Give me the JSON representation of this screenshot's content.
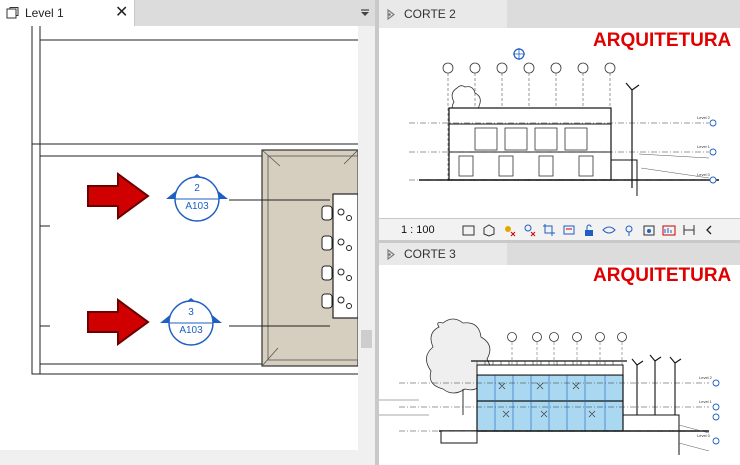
{
  "left_view": {
    "tab_label": "Level 1",
    "callouts": [
      {
        "number": "2",
        "sheet": "A103"
      },
      {
        "number": "3",
        "sheet": "A103"
      }
    ]
  },
  "right_top": {
    "tab_label": "CORTE 2",
    "discipline_title": "ARQUITETURA",
    "scale": "1 : 100"
  },
  "right_bottom": {
    "tab_label": "CORTE 3",
    "discipline_title": "ARQUITETURA"
  },
  "icons": {
    "view_tab": "floor-plan-view-icon",
    "section_tab": "section-view-icon",
    "close": "close-icon",
    "menu": "tab-menu-icon"
  },
  "colors": {
    "callout_blue": "#1e5fc4",
    "arrow_red": "#d10000",
    "title_red": "#e00000",
    "room_fill": "#d6cfbf"
  }
}
